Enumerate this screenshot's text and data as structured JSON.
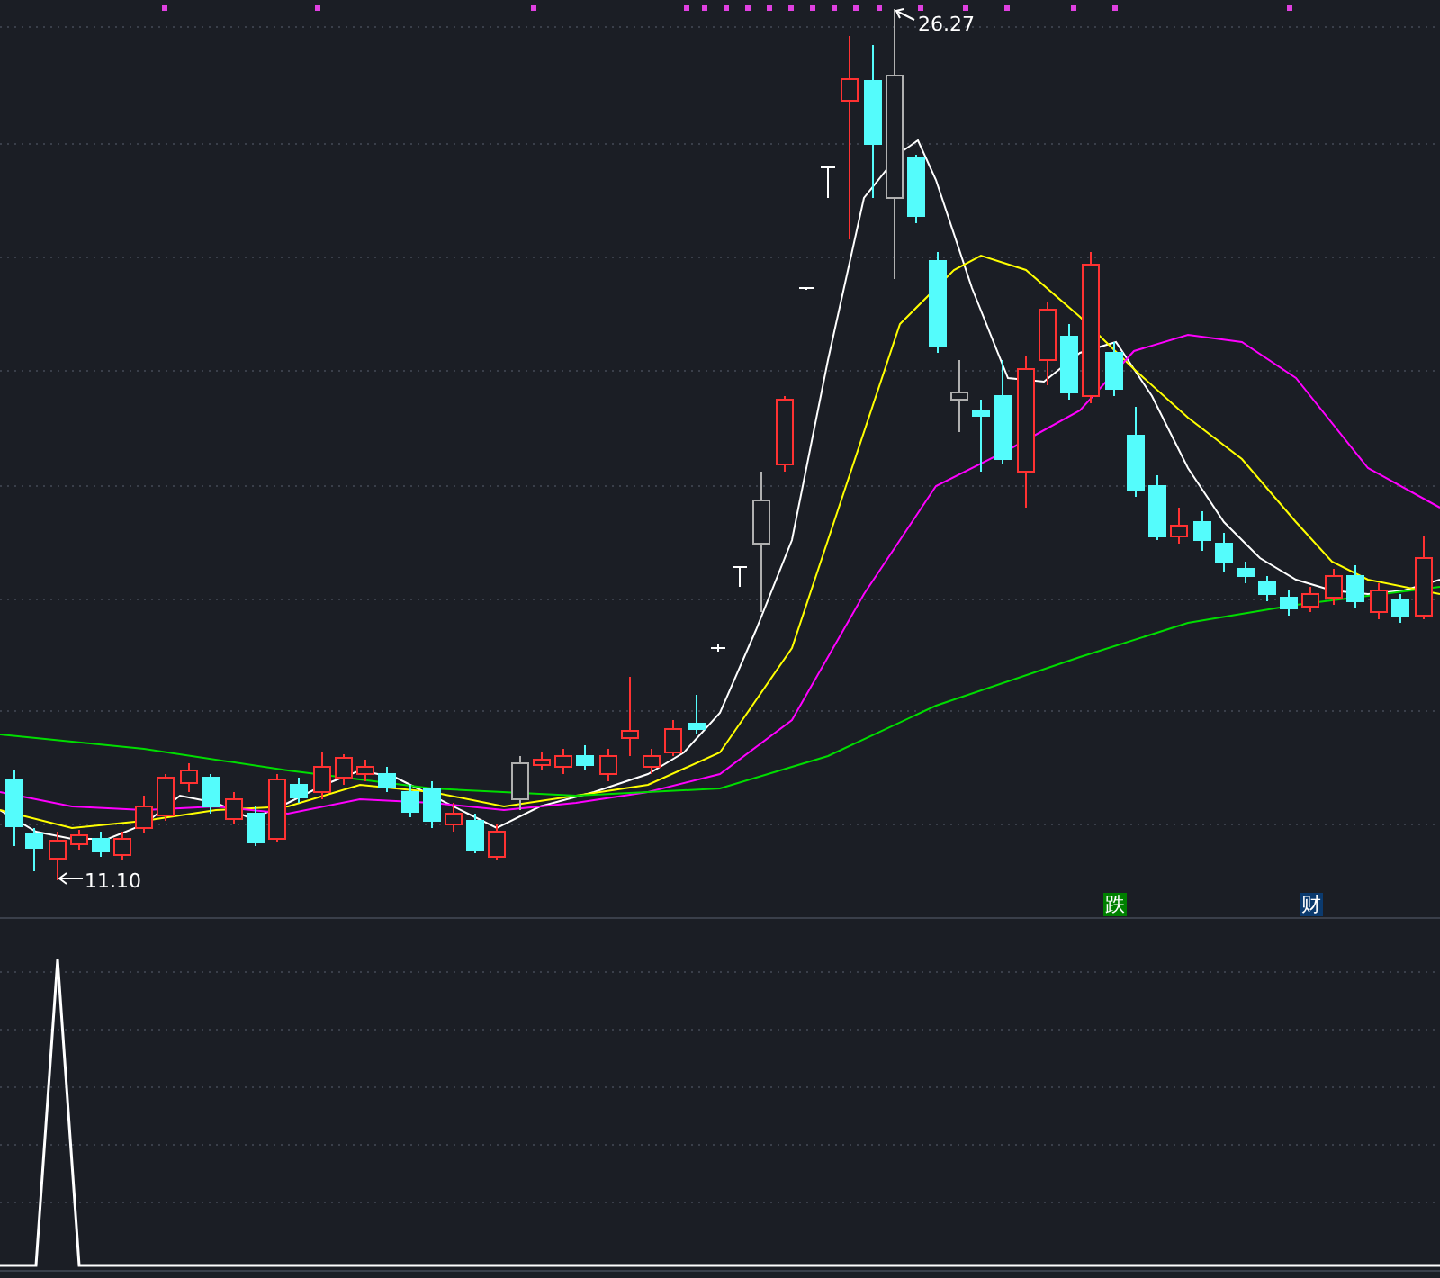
{
  "chart": {
    "high_label": "26.27",
    "low_label": "11.10"
  },
  "markers": [
    {
      "text": "跌",
      "color": "#008000"
    },
    {
      "text": "财",
      "color": "#0b3a6e"
    }
  ]
}
